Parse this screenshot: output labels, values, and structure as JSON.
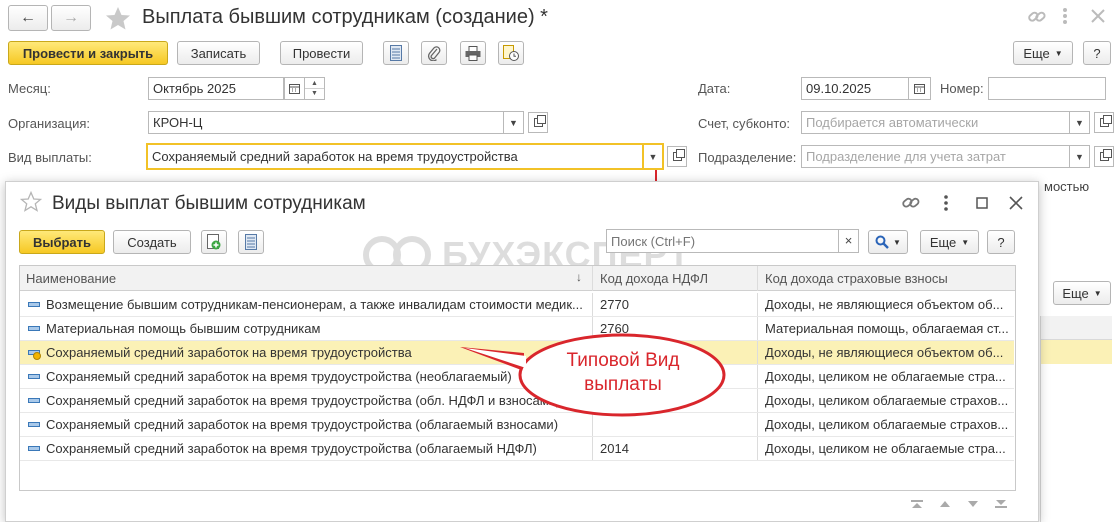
{
  "window": {
    "title": "Выплата бывшим сотрудникам (создание) *",
    "nav_back": "←",
    "nav_forward": "→"
  },
  "toolbar": {
    "post_close": "Провести и закрыть",
    "save": "Записать",
    "post": "Провести",
    "more": "Еще"
  },
  "form": {
    "month_label": "Месяц:",
    "month_value": "Октябрь 2025",
    "org_label": "Организация:",
    "org_value": "КРОН-Ц",
    "paytype_label": "Вид выплаты:",
    "paytype_value": "Сохраняемый средний заработок на время трудоустройства",
    "date_label": "Дата:",
    "date_value": "09.10.2025",
    "number_label": "Номер:",
    "number_value": "",
    "account_label": "Счет, субконто:",
    "account_placeholder": "Подбирается автоматически",
    "dept_label": "Подразделение:",
    "dept_placeholder": "Подразделение для учета затрат",
    "partial_text": "мостью",
    "more2": "Еще"
  },
  "dialog": {
    "title": "Виды выплат бывшим сотрудникам",
    "select": "Выбрать",
    "create": "Создать",
    "search_placeholder": "Поиск (Ctrl+F)",
    "search_clear": "×",
    "more": "Еще",
    "help": "?",
    "watermark": "БУХЭКСПЕРТ",
    "columns": {
      "name": "Наименование",
      "ndfl": "Код дохода НДФЛ",
      "insurance": "Код дохода страховые взносы"
    },
    "rows": [
      {
        "name": "Возмещение бывшим сотрудникам-пенсионерам, а также инвалидам стоимости медик...",
        "ndfl": "2770",
        "insurance": "Доходы, не являющиеся объектом об..."
      },
      {
        "name": "Материальная помощь бывшим сотрудникам",
        "ndfl": "2760",
        "insurance": "Материальная помощь, облагаемая ст..."
      },
      {
        "name": "Сохраняемый средний заработок на время трудоустройства",
        "ndfl": "",
        "insurance": "Доходы, не являющиеся объектом об..."
      },
      {
        "name": "Сохраняемый средний заработок на время трудоустройства (необлагаемый)",
        "ndfl": "",
        "insurance": "Доходы, целиком не облагаемые стра..."
      },
      {
        "name": "Сохраняемый средний заработок на время трудоустройства (обл. НДФЛ и взносами)",
        "ndfl": "",
        "insurance": "Доходы, целиком облагаемые страхов..."
      },
      {
        "name": "Сохраняемый средний заработок на время трудоустройства (облагаемый взносами)",
        "ndfl": "",
        "insurance": "Доходы, целиком облагаемые страхов..."
      },
      {
        "name": "Сохраняемый средний заработок на время трудоустройства (облагаемый НДФЛ)",
        "ndfl": "2014",
        "insurance": "Доходы, целиком не облагаемые стра..."
      }
    ],
    "callout": "Типовой Вид выплаты"
  },
  "colors": {
    "accent_yellow": "#f6c823",
    "selected_row": "#fbf1b6",
    "callout_red": "#d9262c"
  }
}
